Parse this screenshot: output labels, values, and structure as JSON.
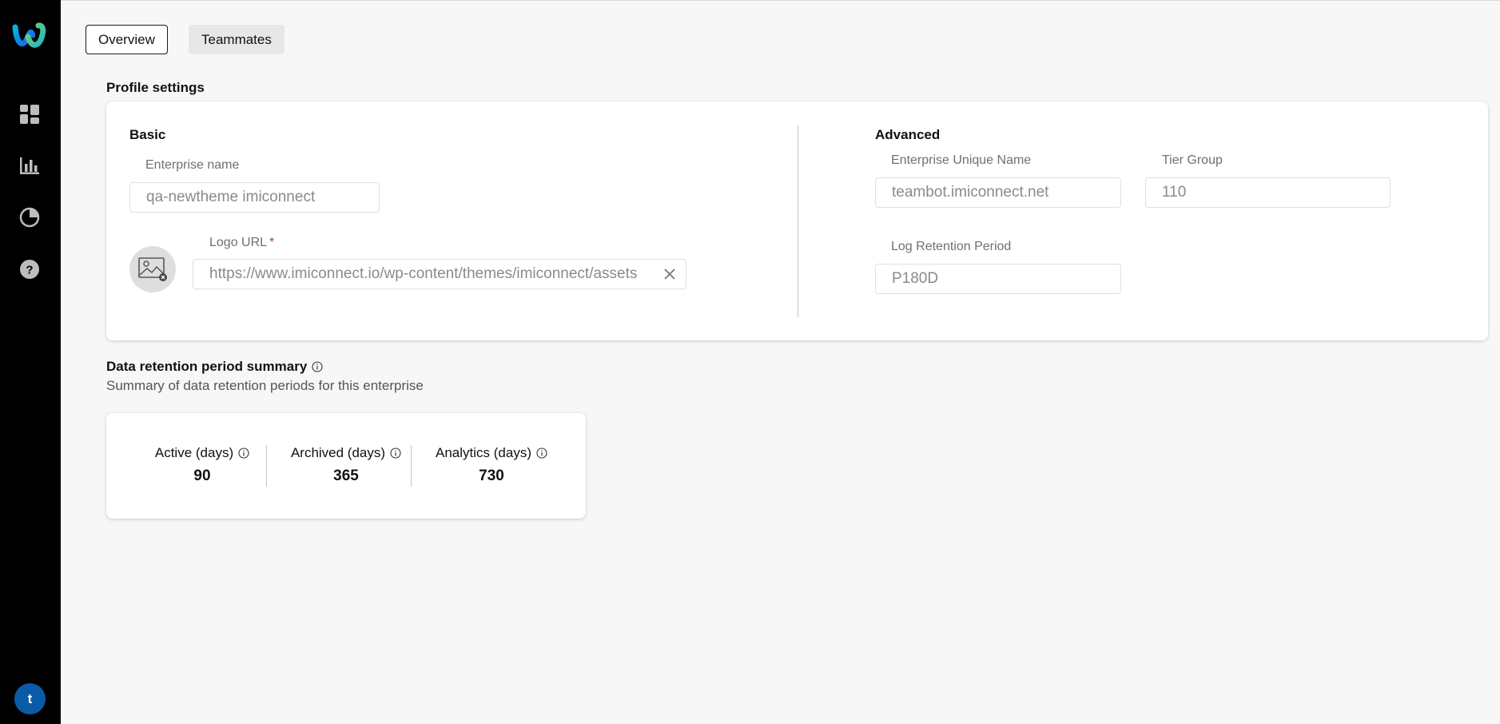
{
  "sidebar": {
    "logo_icon": "webex-logo-icon",
    "nav": [
      {
        "icon": "dashboard-grid-icon"
      },
      {
        "icon": "bar-chart-icon"
      },
      {
        "icon": "pie-chart-icon"
      },
      {
        "icon": "help-icon"
      }
    ],
    "avatar_initial": "t",
    "avatar_color": "#0a5ba6"
  },
  "tabs": [
    {
      "label": "Overview",
      "selected": true
    },
    {
      "label": "Teammates",
      "selected": false
    }
  ],
  "profile": {
    "title": "Profile settings",
    "basic": {
      "title": "Basic",
      "enterprise_name_label": "Enterprise name",
      "enterprise_name_value": "qa-newtheme imiconnect",
      "logo_url_label": "Logo URL",
      "logo_url_required": "*",
      "logo_url_value": "https://www.imiconnect.io/wp-content/themes/imiconnect/assets"
    },
    "advanced": {
      "title": "Advanced",
      "unique_name_label": "Enterprise Unique Name",
      "unique_name_value": "teambot.imiconnect.net",
      "tier_group_label": "Tier Group",
      "tier_group_value": "110",
      "log_retention_label": "Log Retention Period",
      "log_retention_value": "P180D"
    }
  },
  "retention": {
    "title": "Data retention period summary",
    "subtitle": "Summary of data retention periods for this enterprise",
    "stats": [
      {
        "label": "Active (days)",
        "value": "90"
      },
      {
        "label": "Archived (days)",
        "value": "365"
      },
      {
        "label": "Analytics (days)",
        "value": "730"
      }
    ]
  },
  "colors": {
    "sidebar_bg": "#000000",
    "page_bg": "#f7f7f7",
    "required": "#d9332f"
  }
}
